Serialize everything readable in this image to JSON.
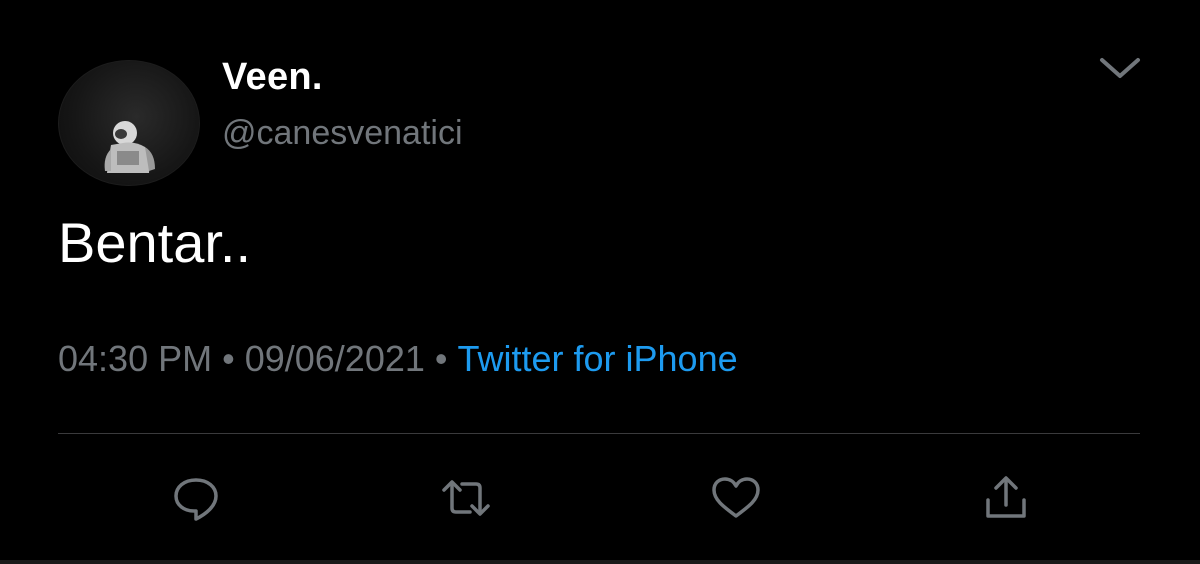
{
  "tweet": {
    "display_name": "Veen.",
    "handle": "@canesvenatici",
    "text": "Bentar..",
    "time": "04:30 PM",
    "date": "09/06/2021",
    "separator": "•",
    "source": "Twitter for iPhone"
  },
  "icons": {
    "more": "chevron-down-icon",
    "reply": "reply-icon",
    "retweet": "retweet-icon",
    "like": "heart-icon",
    "share": "share-icon",
    "avatar": "astronaut-avatar"
  },
  "colors": {
    "background": "#000000",
    "primary_text": "#ffffff",
    "secondary_text": "#71767b",
    "link": "#1d9bf0",
    "divider": "#3a3a3c",
    "icon": "#71767b"
  }
}
